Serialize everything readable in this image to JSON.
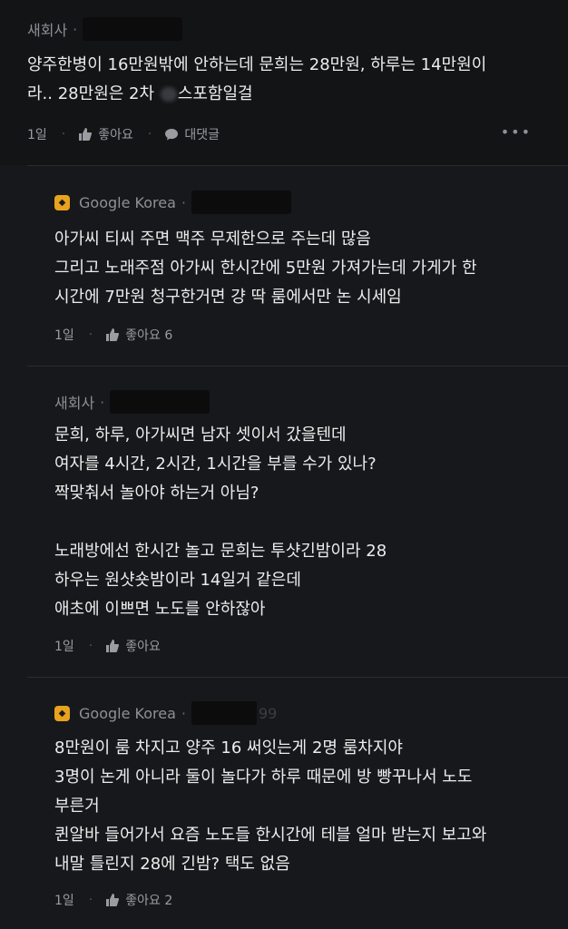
{
  "top_comment": {
    "author": "새회사",
    "body_pre": "양주한병이 16만원밖에 안하는데 문희는 28만원, 하루는 14만원이\n라.. 28만원은 2차 ",
    "body_post": "스포함일걸",
    "time": "1일",
    "like_label": "좋아요",
    "reply_label": "대댓글",
    "more": "•••"
  },
  "replies": [
    {
      "author": "Google Korea",
      "body": "아가씨 티씨 주면 맥주 무제한으로 주는데 많음\n그리고 노래주점 아가씨 한시간에 5만원 가져가는데 가게가 한\n시간에 7만원 청구한거면 걍 딱 룸에서만 논 시세임",
      "time": "1일",
      "like_label": "좋아요 6"
    },
    {
      "author": "새회사",
      "body": "문희, 하루, 아가씨면 남자 셋이서 갔을텐데\n여자를 4시간, 2시간, 1시간을 부를 수가 있나?\n짝맞춰서 놀아야 하는거 아님?\n\n노래방에선 한시간 놀고 문희는 투샷긴밤이라 28\n하우는 원샷숏밤이라 14일거 같은데\n애초에 이쁘면 노도를 안하잖아",
      "time": "1일",
      "like_label": "좋아요"
    },
    {
      "author": "Google Korea",
      "author_suffix": "99",
      "body": "8만원이 룸 차지고 양주 16 써잇는게 2명 룸차지야\n3명이 논게 아니라 둘이 놀다가 하루 때문에 방 빵꾸나서 노도\n부른거\n퀸알바 들어가서 요즘 노도들 한시간에 테블 얼마 받는지 보고와\n내말 틀린지 28에 긴밤? 택도 없음",
      "time": "1일",
      "like_label": "좋아요 2"
    }
  ],
  "colors": {
    "background": "#111214",
    "badge": "#e8a21e",
    "text": "#ececec",
    "muted": "#8e9096"
  }
}
